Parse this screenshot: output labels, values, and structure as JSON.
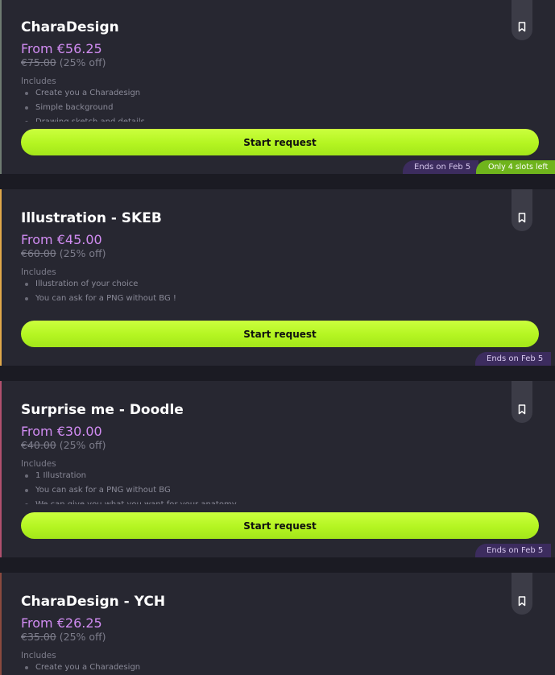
{
  "colors": {
    "background": "#1b1b23",
    "card": "#272731",
    "price": "#d18cf2",
    "button": "#b8f527",
    "tag": "#3c2c5e",
    "slots_tag": "#6fb41c"
  },
  "cards": [
    {
      "title": "CharaDesign",
      "price": "From €56.25",
      "original_price": "€75.00",
      "discount": "(25% off)",
      "includes_label": "Includes",
      "includes": [
        "Create you a Charadesign",
        "Simple background",
        "Drawing sketch and details"
      ],
      "button_label": "Start request",
      "ends": "Ends on Feb 5",
      "slots": "Only 4 slots left",
      "accent_color": "#6f7b72"
    },
    {
      "title": "Illustration - SKEB",
      "price": "From €45.00",
      "original_price": "€60.00",
      "discount": "(25% off)",
      "includes_label": "Includes",
      "includes": [
        "Illustration of your choice",
        "You can ask for a PNG without BG !"
      ],
      "button_label": "Start request",
      "ends": "Ends on Feb 5",
      "accent_color": "#e0a84a"
    },
    {
      "title": "Surprise me - Doodle",
      "price": "From €30.00",
      "original_price": "€40.00",
      "discount": "(25% off)",
      "includes_label": "Includes",
      "includes": [
        "1 Illustration",
        "You can ask for a PNG without BG",
        "We can give you what you want for your anatomy"
      ],
      "button_label": "Start request",
      "ends": "Ends on Feb 5",
      "accent_color": "#b0506e"
    },
    {
      "title": "CharaDesign - YCH",
      "price": "From €26.25",
      "original_price": "€35.00",
      "discount": "(25% off)",
      "includes_label": "Includes",
      "includes": [
        "Create you a Charadesign"
      ],
      "accent_color": "#8a4a3e"
    }
  ]
}
